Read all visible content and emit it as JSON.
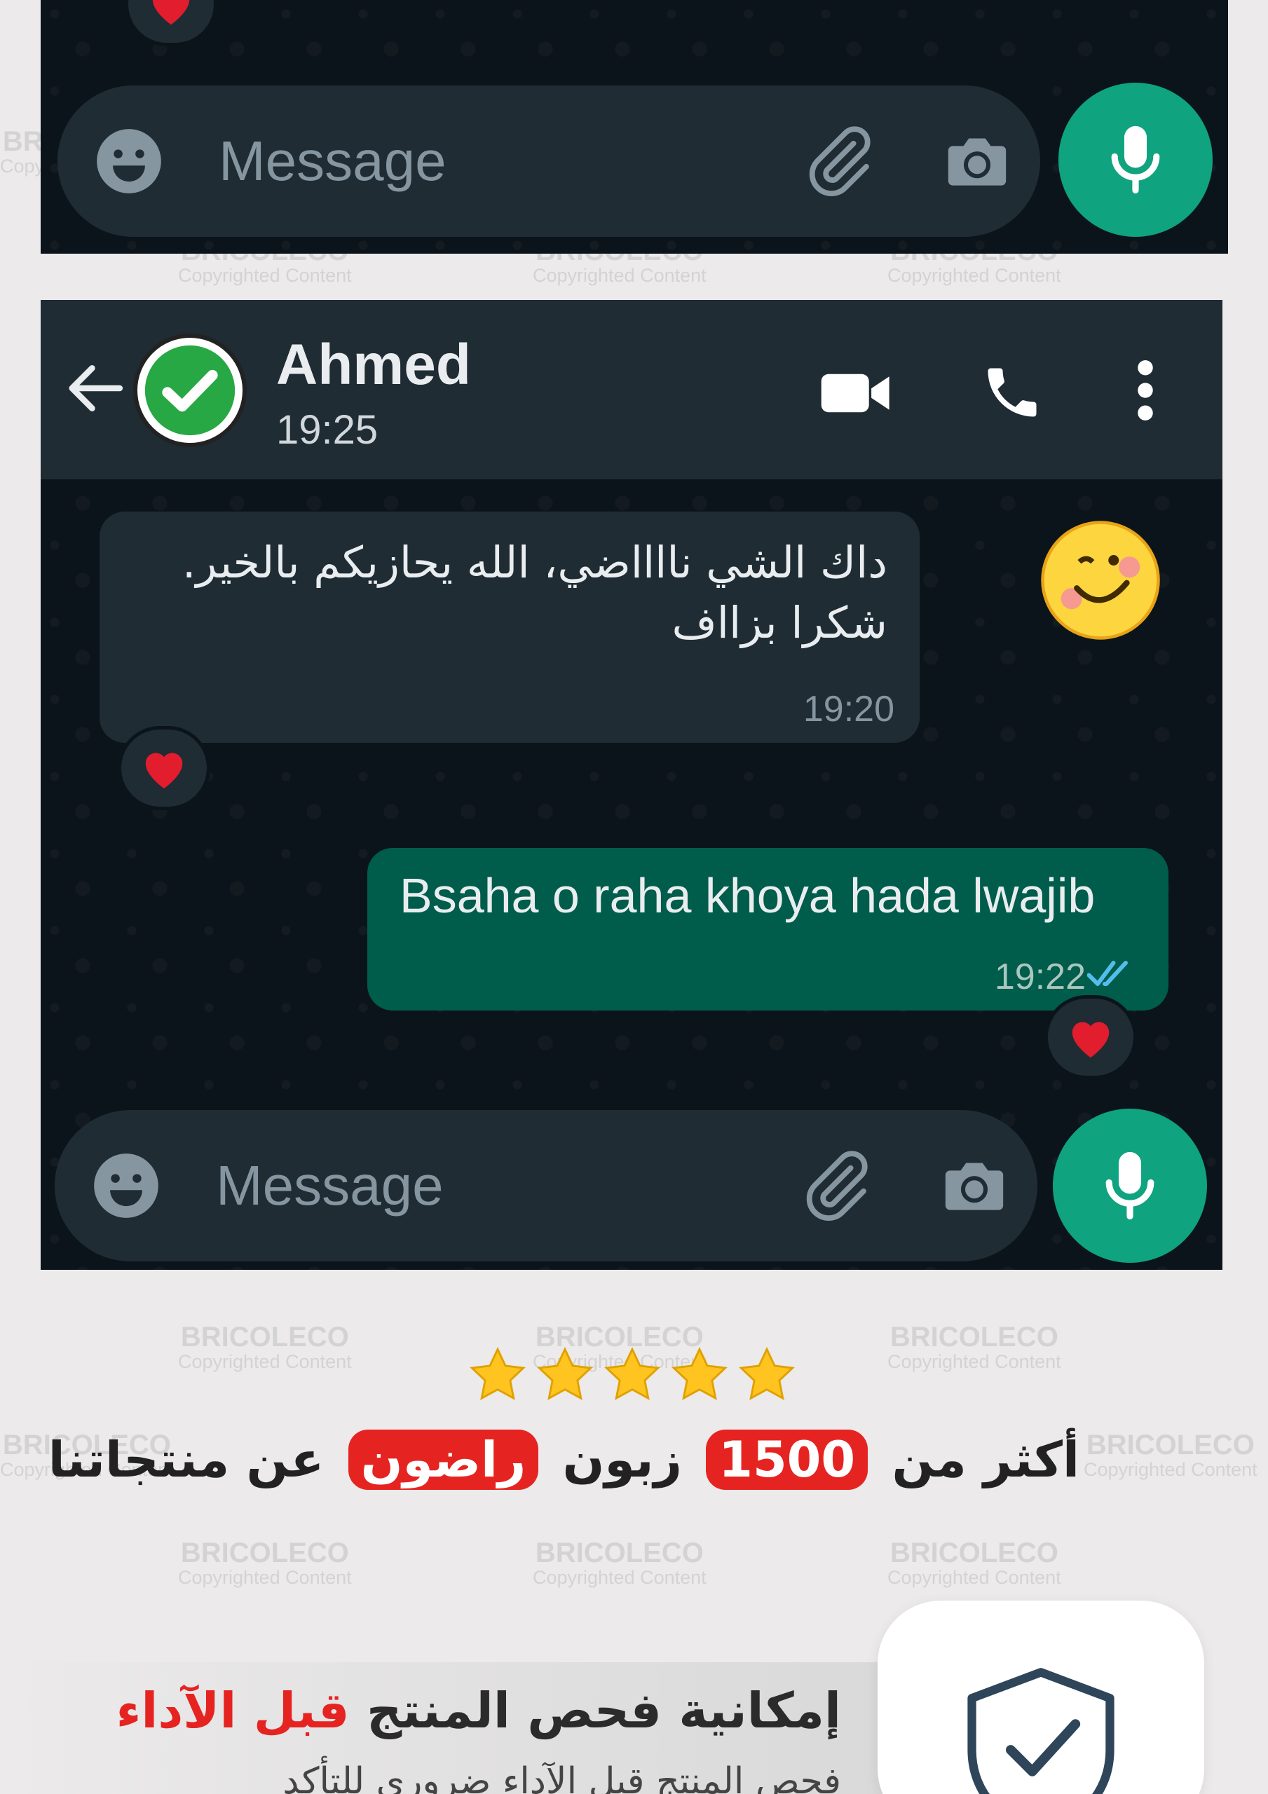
{
  "watermark": {
    "brand": "BRICOLECO",
    "sub": "Copyrighted Content"
  },
  "top_panel": {
    "input": {
      "placeholder": "Message"
    }
  },
  "chat": {
    "header": {
      "contact_name": "Ahmed",
      "status": "19:25"
    },
    "messages": [
      {
        "direction": "incoming",
        "line1": "داك الشي نااااضي، الله يحازيكم بالخير.",
        "line2": "شكرا بزااف",
        "time": "19:20",
        "reaction": "heart"
      },
      {
        "direction": "outgoing",
        "text": "Bsaha o raha khoya hada lwajib",
        "time": "19:22",
        "ticks": "read",
        "reaction": "heart"
      }
    ],
    "input": {
      "placeholder": "Message"
    }
  },
  "rating": {
    "stars": 5,
    "headline_part1": "أكثر من",
    "headline_number": "1500",
    "headline_part2": "زبون",
    "headline_highlight": "راضون",
    "headline_part3": "عن منتجاتنا"
  },
  "feature": {
    "title_part1": "إمكانية فحص المنتج",
    "title_highlight": "قبل الآداء",
    "subtitle": "فحص المنتج قبل الآداء ضروري للتأكد"
  },
  "colors": {
    "chat_bg": "#0b141a",
    "header_bg": "#1f2c34",
    "outgoing_bubble": "#005c4b",
    "accent_green": "#0fa37f",
    "highlight_red": "#e52421",
    "read_ticks": "#53bdeb"
  }
}
